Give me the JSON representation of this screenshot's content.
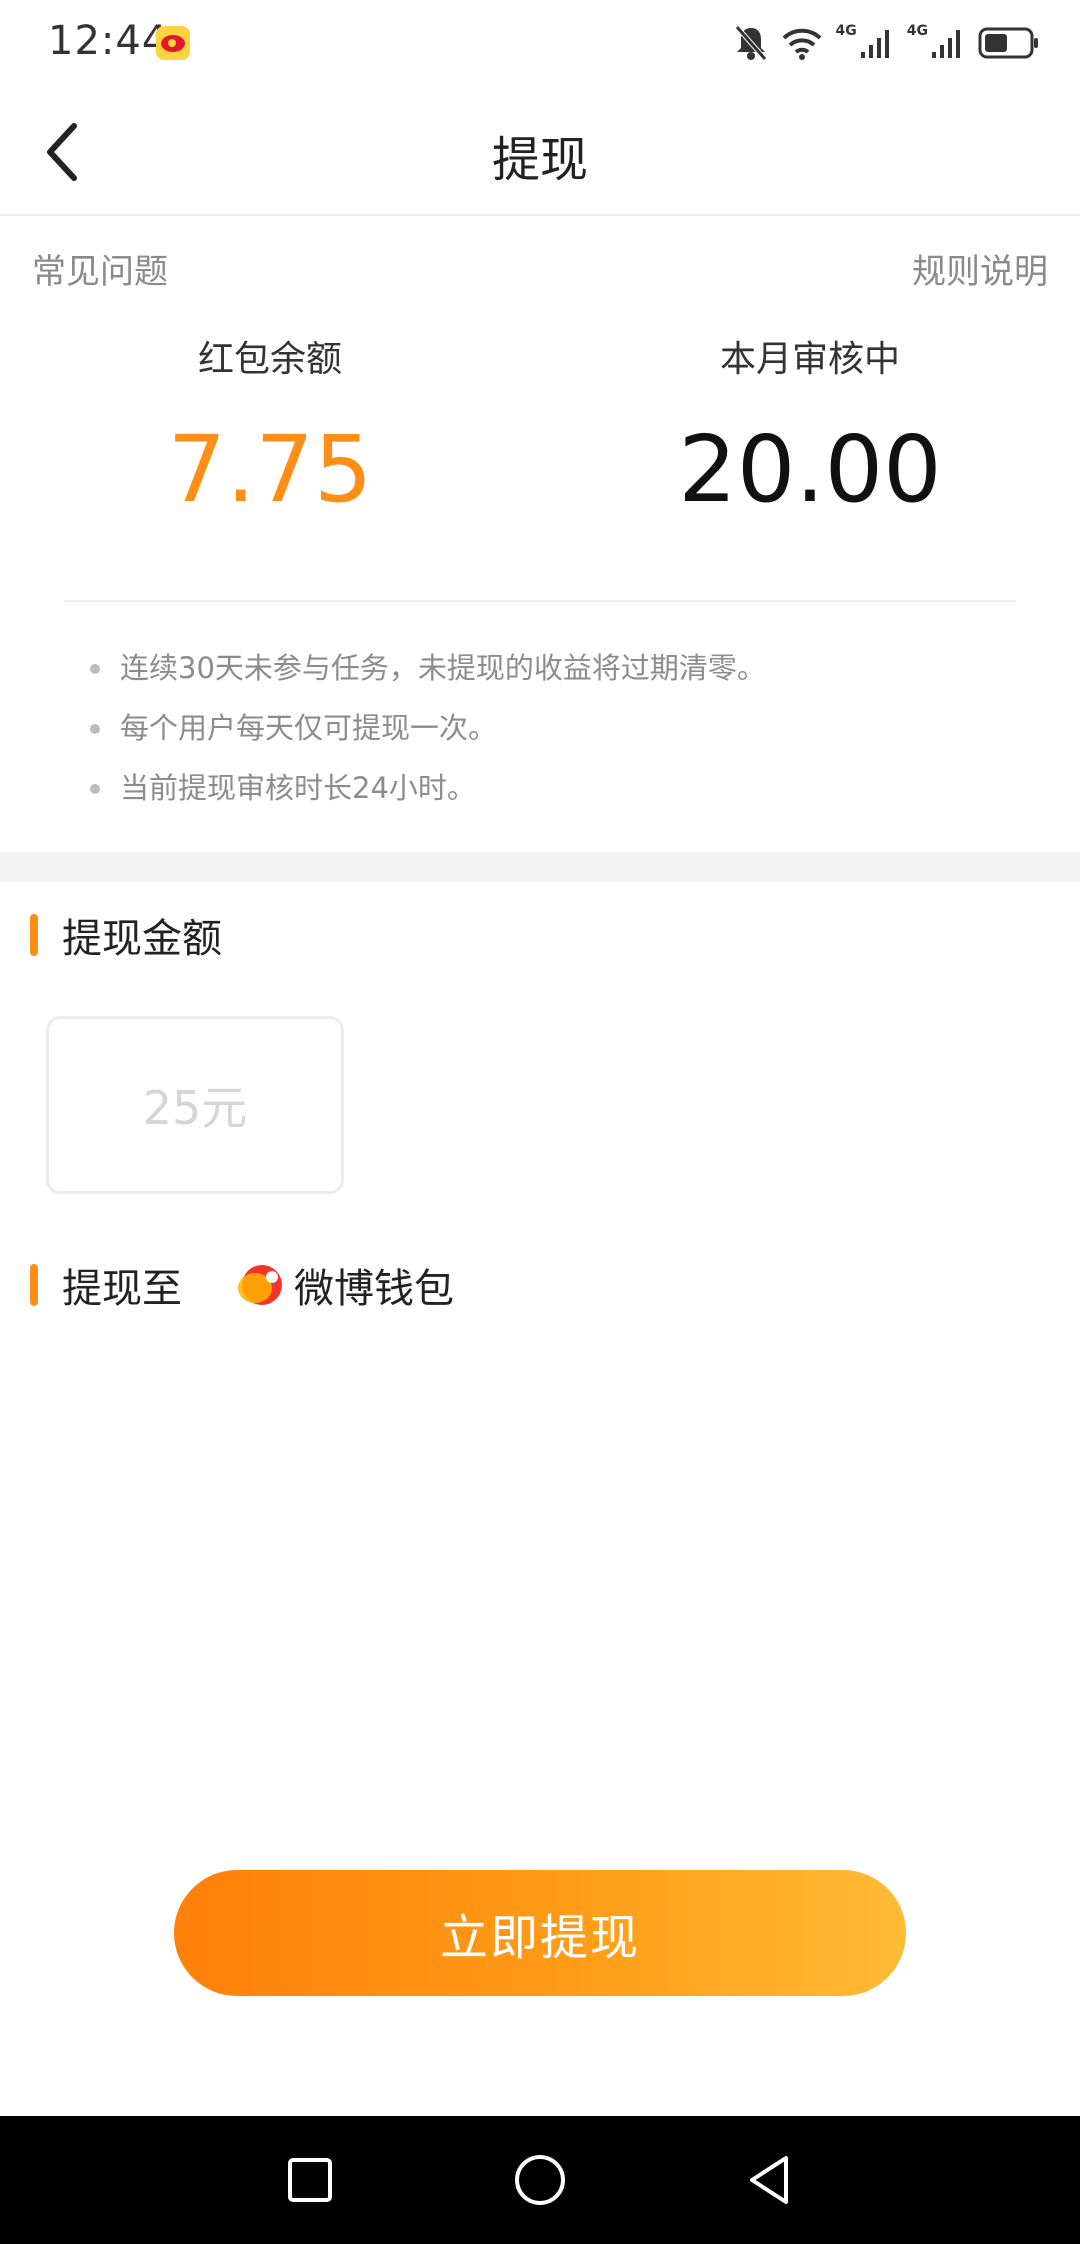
{
  "status_bar": {
    "time": "12:44",
    "network_1": "4G",
    "network_2": "4G",
    "icons": [
      "weibo-notification-icon",
      "mute-bell-icon",
      "wifi-icon",
      "signal-icon",
      "signal-icon",
      "battery-icon"
    ]
  },
  "header": {
    "title": "提现",
    "back_icon": "chevron-left-icon"
  },
  "links": {
    "faq": "常见问题",
    "rules": "规则说明"
  },
  "stats": {
    "balance_label": "红包余额",
    "balance_value": "7.75",
    "review_label": "本月审核中",
    "review_value": "20.00"
  },
  "notes": [
    "连续30天未参与任务，未提现的收益将过期清零。",
    "每个用户每天仅可提现一次。",
    "当前提现审核时长24小时。"
  ],
  "amount_section": {
    "title": "提现金额",
    "options": [
      "25元"
    ]
  },
  "target_section": {
    "title": "提现至",
    "wallet_name": "微博钱包",
    "wallet_icon": "weibo-wallet-icon"
  },
  "submit": {
    "label": "立即提现"
  },
  "nav": {
    "icons": [
      "recent-apps-icon",
      "home-icon",
      "back-triangle-icon"
    ]
  },
  "colors": {
    "accent": "#ff8e16",
    "button_gradient_start": "#ff7f0a",
    "button_gradient_end": "#ffbb36"
  }
}
